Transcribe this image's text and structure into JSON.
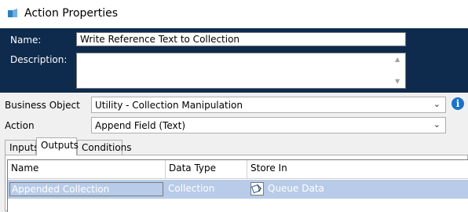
{
  "window": {
    "title": "Action Properties"
  },
  "header": {
    "name_label": "Name:",
    "name_value": "Write Reference Text to Collection",
    "description_label": "Description:",
    "description_value": ""
  },
  "form": {
    "business_object_label": "Business Object",
    "business_object_value": "Utility - Collection Manipulation",
    "action_label": "Action",
    "action_value": "Append Field (Text)"
  },
  "tabs": [
    {
      "label": "Inputs",
      "active": false
    },
    {
      "label": "Outputs",
      "active": true
    },
    {
      "label": "Conditions",
      "active": false
    }
  ],
  "outputs_table": {
    "columns": [
      "Name",
      "Data Type",
      "Store In"
    ],
    "rows": [
      {
        "name": "Appended Collection",
        "data_type": "Collection",
        "store_in": "Queue Data",
        "selected": true
      }
    ]
  },
  "colors": {
    "header_bg": "#0e2a4d",
    "selected_row": "#b8cbe8",
    "info_icon": "#1a73c9"
  }
}
